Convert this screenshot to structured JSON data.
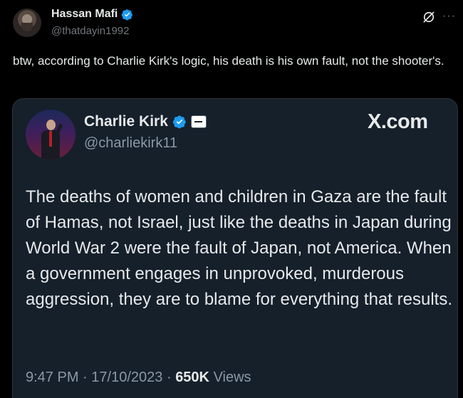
{
  "post": {
    "author_name": "Hassan Mafi",
    "author_handle": "@thatdayin1992",
    "text": "btw, according to Charlie Kirk's logic, his death is his own fault, not the shooter's.",
    "more_label": "···"
  },
  "quoted": {
    "author_name": "Charlie Kirk",
    "author_handle": "@charliekirk11",
    "site": "X.com",
    "text": "The deaths of women and children in Gaza are the fault of Hamas, not Israel, just like the deaths in Japan during World War 2 were the fault of Japan, not America. When a government engages in unprovoked, murderous aggression, they are to blame for everything that results.",
    "time": "9:47 PM",
    "separator": "·",
    "date": "17/10/2023",
    "views_count": "650K",
    "views_label": "Views"
  },
  "icons": {
    "verified": "verified-badge-icon",
    "affiliation": "affiliation-badge-icon",
    "grok": "grok-icon",
    "more": "more-icon"
  },
  "colors": {
    "background": "#000000",
    "card_background": "#15202b",
    "verified_blue": "#1d9bf0",
    "text_primary": "#e7e9ea",
    "text_secondary": "#71767b"
  }
}
